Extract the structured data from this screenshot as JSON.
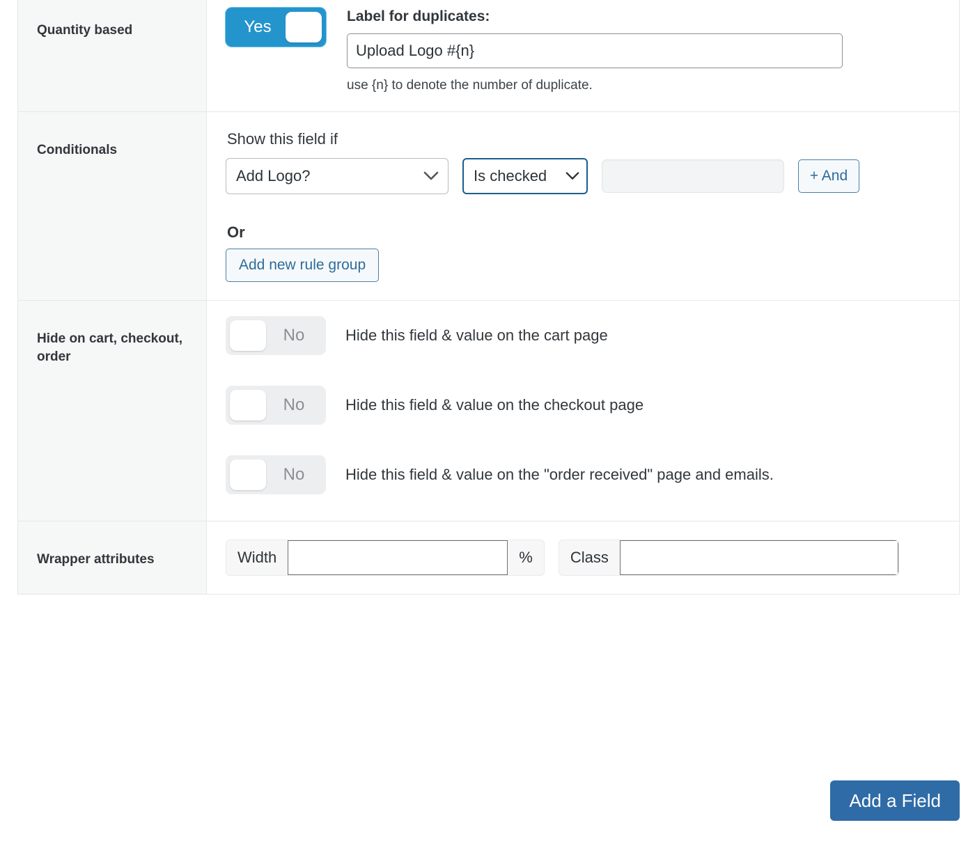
{
  "colors": {
    "toggle_on": "#2494cd",
    "toggle_off_track": "#edeef0",
    "primary_button": "#2f6ca7",
    "link_blue": "#2c6c9b",
    "focus_border": "#1b5d8e",
    "label_column_bg": "#f6f7f7"
  },
  "rows": {
    "quantity_based": {
      "label": "Quantity based",
      "toggle": {
        "state": "on",
        "text": "Yes"
      },
      "duplicates_title": "Label for duplicates:",
      "duplicates_value": "Upload Logo #{n}",
      "duplicates_placeholder": "",
      "help": "use {n} to denote the number of duplicate."
    },
    "conditionals": {
      "label": "Conditionals",
      "intro": "Show this field if",
      "field_select": "Add Logo?",
      "operator_select": "Is checked",
      "value_input": "",
      "value_placeholder": "",
      "and_button": "+ And",
      "or_label": "Or",
      "add_rule_group_button": "Add new rule group"
    },
    "hide_on": {
      "label": "Hide on cart, checkout, order",
      "items": [
        {
          "toggle": "No",
          "text": "Hide this field & value on the cart page"
        },
        {
          "toggle": "No",
          "text": "Hide this field & value on the checkout page"
        },
        {
          "toggle": "No",
          "text": "Hide this field & value on the \"order received\" page and emails."
        }
      ]
    },
    "wrapper": {
      "label": "Wrapper attributes",
      "width_addon": "Width",
      "width_value": "",
      "width_placeholder": "",
      "percent_addon": "%",
      "class_addon": "Class",
      "class_value": "",
      "class_placeholder": ""
    }
  },
  "footer": {
    "add_field_button": "Add a Field"
  }
}
